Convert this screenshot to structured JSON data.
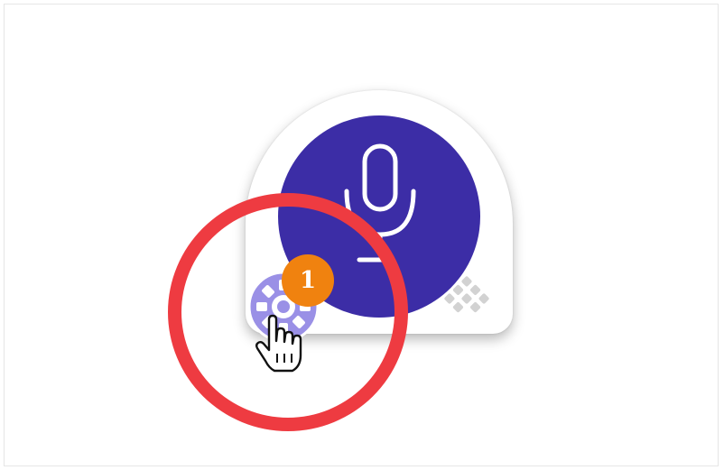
{
  "widget": {
    "notification_count": "1",
    "icons": {
      "mic": "microphone-icon",
      "settings": "gear-icon",
      "drag": "grip-dots-icon",
      "cursor": "hand-pointer-icon"
    }
  },
  "colors": {
    "mic_button": "#3c2da6",
    "settings_gear": "#9a90e6",
    "badge": "#f0820f",
    "highlight_ring": "#ee3b41",
    "grip_dots": "#d2d2d2"
  }
}
